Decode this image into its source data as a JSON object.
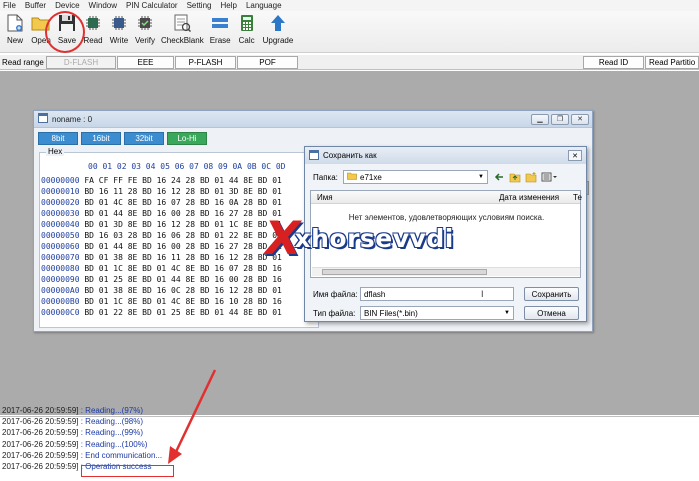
{
  "menu": [
    "File",
    "Buffer",
    "Device",
    "Window",
    "PIN Calculator",
    "Setting",
    "Help",
    "Language"
  ],
  "toolbar": [
    {
      "label": "New",
      "icon": "new-file-icon"
    },
    {
      "label": "Open",
      "icon": "open-folder-icon"
    },
    {
      "label": "Save",
      "icon": "floppy-save-icon"
    },
    {
      "label": "Read",
      "icon": "chip-read-icon"
    },
    {
      "label": "Write",
      "icon": "chip-write-icon"
    },
    {
      "label": "Verify",
      "icon": "chip-verify-icon"
    },
    {
      "label": "CheckBlank",
      "icon": "check-blank-icon"
    },
    {
      "label": "Erase",
      "icon": "erase-icon"
    },
    {
      "label": "Calc",
      "icon": "calculator-icon"
    },
    {
      "label": "Upgrade",
      "icon": "upgrade-arrow-icon"
    }
  ],
  "range": {
    "label": "Read range",
    "tabs": [
      "D-FLASH",
      "EEE",
      "P-FLASH",
      "POF"
    ],
    "read_id": "Read ID",
    "read_partition": "Read Partitio"
  },
  "hexwin": {
    "title": "noname : 0",
    "modes": [
      "8bit",
      "16bit",
      "32bit",
      "Lo-Hi"
    ],
    "section": "Hex",
    "header": "00 01 02 03 04 05 06 07 08 09 0A 0B 0C 0D",
    "rows": [
      {
        "addr": "00000000",
        "bytes": "FA CF FF FE BD 16 24 28 BD 01 44 8E BD 01"
      },
      {
        "addr": "00000010",
        "bytes": "BD 16 11 28 BD 16 12 28 BD 01 3D 8E BD 01"
      },
      {
        "addr": "00000020",
        "bytes": "BD 01 4C 8E BD 16 07 28 BD 16 0A 28 BD 01"
      },
      {
        "addr": "00000030",
        "bytes": "BD 01 44 8E BD 16 00 28 BD 16 27 28 BD 01"
      },
      {
        "addr": "00000040",
        "bytes": "BD 01 3D 8E BD 16 12 28 BD 01 1C 8E BD 01"
      },
      {
        "addr": "00000050",
        "bytes": "BD 16 03 28 BD 16 06 28 BD 01 22 8E BD 01"
      },
      {
        "addr": "00000060",
        "bytes": "BD 01 44 8E BD 16 00 28 BD 16 27 28 BD 01"
      },
      {
        "addr": "00000070",
        "bytes": "BD 01 38 8E BD 16 11 28 BD 16 12 28 BD 01"
      },
      {
        "addr": "00000080",
        "bytes": "BD 01 1C 8E BD 01 4C 8E BD 16 07 28 BD 16"
      },
      {
        "addr": "00000090",
        "bytes": "BD 01 25 8E BD 01 44 8E BD 16 00 28 BD 16"
      },
      {
        "addr": "000000A0",
        "bytes": "BD 01 38 8E BD 16 0C 28 BD 16 12 28 BD 01"
      },
      {
        "addr": "000000B0",
        "bytes": "BD 01 1C 8E BD 01 4C 8E BD 16 10 28 BD 16"
      },
      {
        "addr": "000000C0",
        "bytes": "BD 01 22 8E BD 01 25 8E BD 01 44 8E BD 01"
      }
    ]
  },
  "dialog": {
    "title": "Сохранить как",
    "folder_label": "Папка:",
    "folder_value": "e71xe",
    "col_name": "Имя",
    "col_date": "Дата изменения",
    "col_more": "Те",
    "empty_text": "Нет элементов, удовлетворяющих условиям поиска.",
    "filename_label": "Имя файла:",
    "filename_value": "dflash",
    "filetype_label": "Тип файла:",
    "filetype_value": "BIN Files(*.bin)",
    "save_button": "Сохранить",
    "cancel_button": "Отмена"
  },
  "watermark": {
    "brand": "xhorsevvdi"
  },
  "log": [
    {
      "ts": "2017-06-26 20:59:59]",
      "msg": ": Reading...(97%)"
    },
    {
      "ts": "2017-06-26 20:59:59]",
      "msg": ": Reading...(98%)"
    },
    {
      "ts": "2017-06-26 20:59:59]",
      "msg": ": Reading...(99%)"
    },
    {
      "ts": "2017-06-26 20:59:59]",
      "msg": ": Reading...(100%)"
    },
    {
      "ts": "2017-06-26 20:59:59]",
      "msg": ": End communication..."
    },
    {
      "ts": "2017-06-26 20:59:59]",
      "msg": ": Operation success"
    }
  ],
  "colors": {
    "highlight": "#e23030",
    "mode_blue": "#3c8cd0",
    "mode_green": "#3aa85a",
    "workspace": "#ababab"
  }
}
